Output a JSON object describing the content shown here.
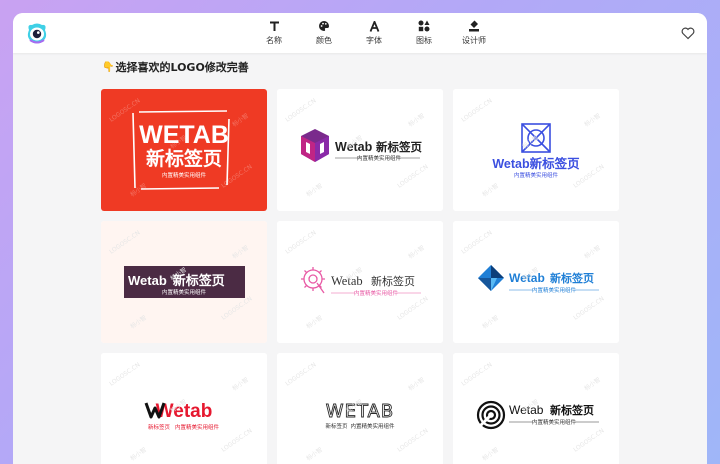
{
  "nav": [
    {
      "label": "名称",
      "icon": "text-icon"
    },
    {
      "label": "颜色",
      "icon": "palette-icon"
    },
    {
      "label": "字体",
      "icon": "font-icon"
    },
    {
      "label": "图标",
      "icon": "shapes-icon"
    },
    {
      "label": "设计师",
      "icon": "designer-icon"
    }
  ],
  "heading": {
    "emoji": "👇",
    "text": "选择喜欢的LOGO修改完善"
  },
  "watermark": {
    "site": "LOGOSC.CN",
    "mark": "标小智"
  },
  "cards": [
    {
      "name": "WETAB",
      "cn": "新标签页",
      "slogan": "内置精美实用组件",
      "bg": "#ef3a24"
    },
    {
      "name": "Wetab",
      "cn": "新标签页",
      "slogan": "内置精美实用组件",
      "bg": "#ffffff"
    },
    {
      "name": "Wetab",
      "cn": "新标签页",
      "slogan": "内置精美实用组件",
      "bg": "#ffffff"
    },
    {
      "name": "Wetab",
      "cn": "新标签页",
      "slogan": "内置精美实用组件",
      "bg": "#fff5f1"
    },
    {
      "name": "Wetab",
      "cn": "新标签页",
      "slogan": "内置精美实用组件",
      "bg": "#ffffff"
    },
    {
      "name": "Wetab",
      "cn": "新标签页",
      "slogan": "内置精美实用组件",
      "bg": "#ffffff"
    },
    {
      "name": "Wetab",
      "cn": "新标签页",
      "slogan": "内置精美实用组件",
      "bg": "#ffffff"
    },
    {
      "name": "WETAB",
      "cn": "新标签页",
      "slogan": "内置精美实用组件",
      "bg": "#ffffff"
    },
    {
      "name": "Wetab",
      "cn": "新标签页",
      "slogan": "内置精美实用组件",
      "bg": "#ffffff"
    }
  ]
}
